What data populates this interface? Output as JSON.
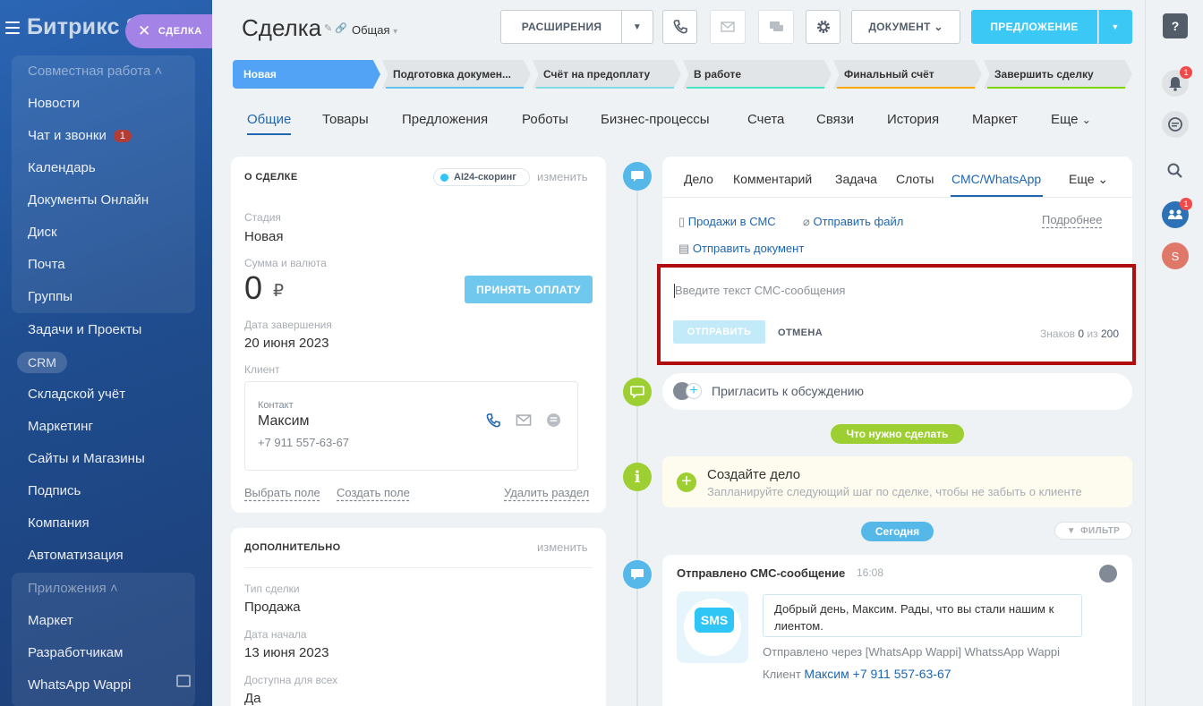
{
  "sidebar": {
    "logo": "Битрикс 2",
    "deal_chip": "СДЕЛКА",
    "group1_title": "Совместная работа",
    "group1_items": [
      "Новости",
      "Чат и звонки",
      "Календарь",
      "Документы Онлайн",
      "Диск",
      "Почта",
      "Группы"
    ],
    "chat_badge": "1",
    "items": [
      "Задачи и Проекты",
      "CRM",
      "Складской учёт",
      "Маркетинг",
      "Сайты и Магазины",
      "Подпись",
      "Компания",
      "Автоматизация"
    ],
    "group2_title": "Приложения",
    "group2_items": [
      "Маркет",
      "Разработчикам",
      "WhatsApp Wappi"
    ]
  },
  "header": {
    "title": "Сделка",
    "category": "Общая",
    "btn_extensions": "РАСШИРЕНИЯ",
    "btn_document": "ДОКУМЕНТ",
    "btn_offer": "ПРЕДЛОЖЕНИЕ"
  },
  "stages": [
    {
      "label": "Новая",
      "color": "#52a3f5"
    },
    {
      "label": "Подготовка докумен...",
      "color": "#63c3f0"
    },
    {
      "label": "Счёт на предоплату",
      "color": "#7fdce6"
    },
    {
      "label": "В работе",
      "color": "#47e4c2"
    },
    {
      "label": "Финальный счёт",
      "color": "#ffa900"
    },
    {
      "label": "Завершить сделку",
      "color": "#7bd500"
    }
  ],
  "tabs": [
    "Общие",
    "Товары",
    "Предложения",
    "Роботы",
    "Бизнес-процессы",
    "Счета",
    "Связи",
    "История",
    "Маркет",
    "Еще"
  ],
  "about": {
    "title": "О СДЕЛКЕ",
    "ai_chip": "AI24-скоринг",
    "edit": "изменить",
    "stage_label": "Стадия",
    "stage_value": "Новая",
    "sum_label": "Сумма и валюта",
    "sum_value": "0",
    "currency": "₽",
    "pay_button": "ПРИНЯТЬ ОПЛАТУ",
    "close_date_label": "Дата завершения",
    "close_date_value": "20 июня 2023",
    "client_label": "Клиент",
    "contact_label": "Контакт",
    "contact_name": "Максим",
    "contact_phone": "+7 911 557-63-67",
    "select_field": "Выбрать поле",
    "create_field": "Создать поле",
    "delete_section": "Удалить раздел"
  },
  "extra": {
    "title": "ДОПОЛНИТЕЛЬНО",
    "edit": "изменить",
    "type_label": "Тип сделки",
    "type_value": "Продажа",
    "start_label": "Дата начала",
    "start_value": "13 июня 2023",
    "avail_label": "Доступна для всех",
    "avail_value": "Да"
  },
  "editor": {
    "tabs": [
      "Дело",
      "Комментарий",
      "Задача",
      "Слоты",
      "СМС/WhatsApp",
      "Еще"
    ],
    "link_sales": "Продажи в СМС",
    "link_file": "Отправить файл",
    "link_more": "Подробнее",
    "link_doc": "Отправить документ",
    "placeholder": "Введите текст СМС-сообщения",
    "send": "ОТПРАВИТЬ",
    "cancel": "ОТМЕНА",
    "counter_label": "Знаков",
    "counter_value": "0",
    "counter_of": "из",
    "counter_max": "200"
  },
  "timeline": {
    "invite": "Пригласить к обсуждению",
    "todo_pill": "Что нужно сделать",
    "todo_title": "Создайте дело",
    "todo_sub": "Запланируйте следующий шаг по сделке, чтобы не забыть о клиенте",
    "today_pill": "Сегодня",
    "filter": "ФИЛЬТР",
    "event_title": "Отправлено СМС-сообщение",
    "event_time": "16:08",
    "sms_icon_text": "SMS",
    "message": "Добрый день, Максим. Рады, что вы стали нашим к лиентом.",
    "sent_via": "Отправлено через [WhatsApp Wappi] WhatssApp Wappi",
    "client_label": "Клиент",
    "client_value": "Максим +7 911 557-63-67"
  },
  "rail": {
    "notif_badge": "1",
    "chat_badge": "1",
    "avatar_letter": "S"
  }
}
